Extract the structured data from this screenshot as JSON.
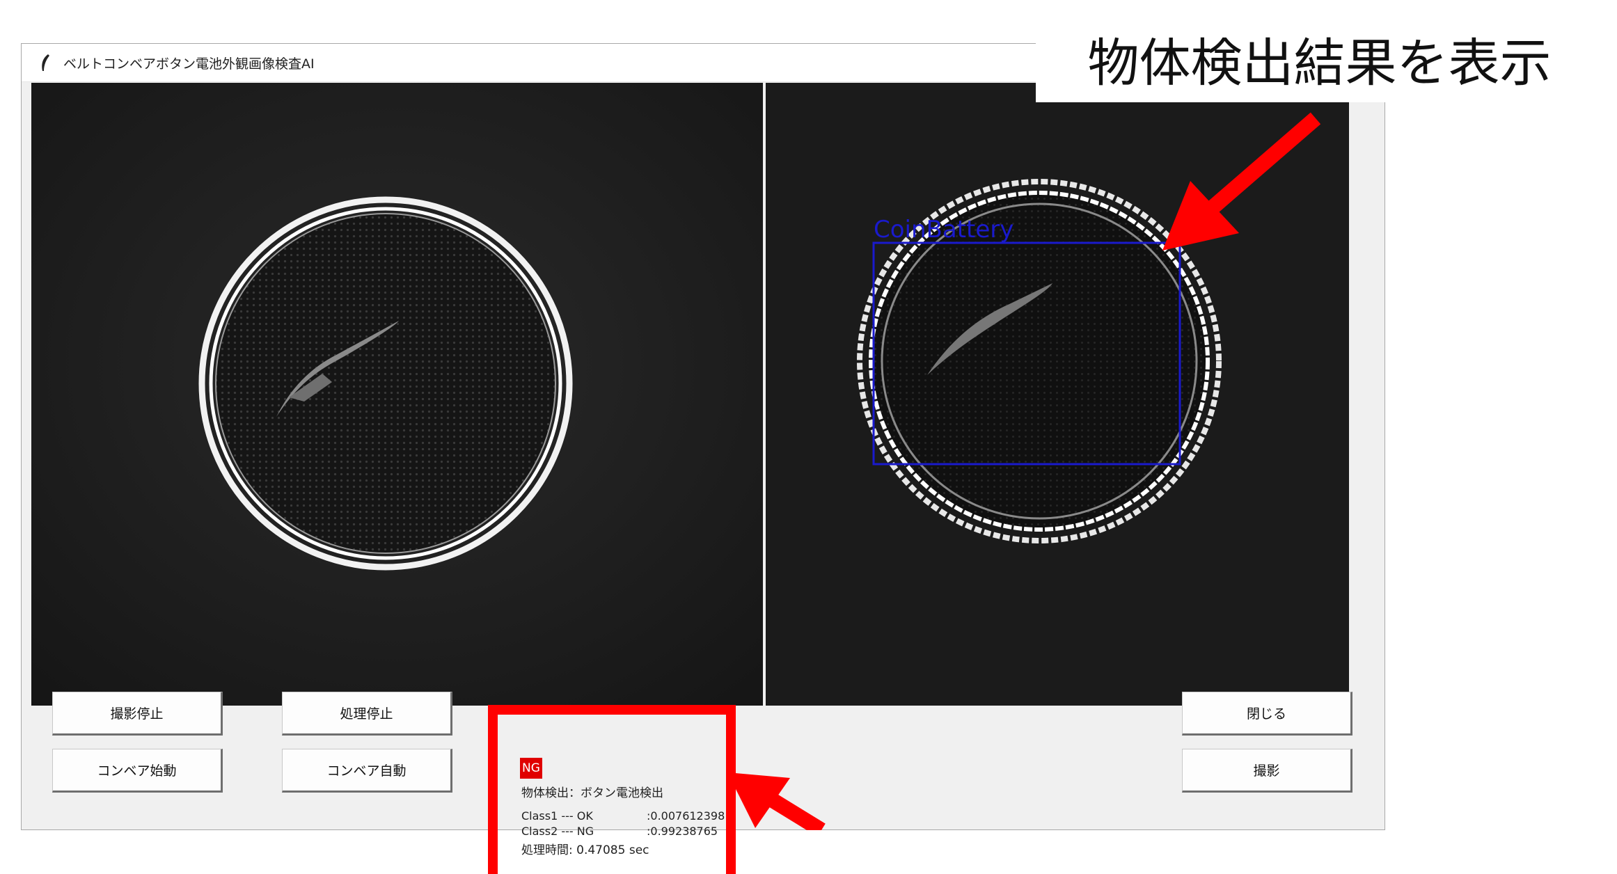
{
  "window": {
    "title": "ベルトコンベアボタン電池外観画像検査AI"
  },
  "callout": {
    "text": "物体検出結果を表示"
  },
  "detection": {
    "label": "CoinBattery"
  },
  "buttons": {
    "capture_stop": "撮影停止",
    "process_stop": "処理停止",
    "conveyor_start": "コンベア始動",
    "conveyor_auto": "コンベア自動",
    "close": "閉じる",
    "capture": "撮影"
  },
  "result": {
    "status": "NG",
    "detection_text": "物体検出：ボタン電池検出",
    "class1_label": "Class1 --- OK",
    "class1_value": ":0.007612398",
    "class2_label": "Class2 --- NG",
    "class2_value": ":0.99238765",
    "time_text": "処理時間: 0.47085 sec"
  },
  "colors": {
    "annotation": "#ff0000",
    "ng_badge": "#e00000",
    "bbox": "#1a1acc",
    "window_bg": "#f0f0f0"
  }
}
